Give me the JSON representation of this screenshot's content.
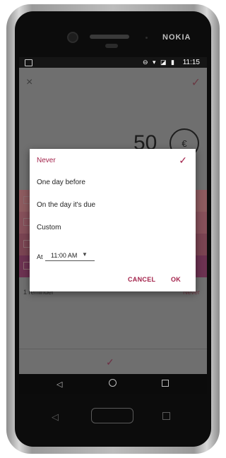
{
  "device": {
    "brand": "NOKIA"
  },
  "status_bar": {
    "time": "11:15",
    "icons": "⊖ ▾ ◪ ▮"
  },
  "app_bar": {
    "close_icon": "×",
    "confirm_icon": "✓"
  },
  "amount": {
    "value": "50",
    "currency": "€"
  },
  "background": {
    "reminders_label": "1 reminder",
    "reminders_value": "Never",
    "bottom_confirm_icon": "✓"
  },
  "dialog": {
    "options": [
      {
        "label": "Never",
        "selected": true
      },
      {
        "label": "One day before",
        "selected": false
      },
      {
        "label": "On the day it's due",
        "selected": false
      },
      {
        "label": "Custom",
        "selected": false
      }
    ],
    "selected_icon": "✓",
    "at_label": "At",
    "time_value": "11:00 AM",
    "time_dropdown_icon": "▼",
    "cancel_label": "CANCEL",
    "ok_label": "OK",
    "accent_color": "#a3234b"
  },
  "navigation": {
    "back_icon": "◁",
    "home_icon": "○",
    "recents_icon": "□"
  }
}
